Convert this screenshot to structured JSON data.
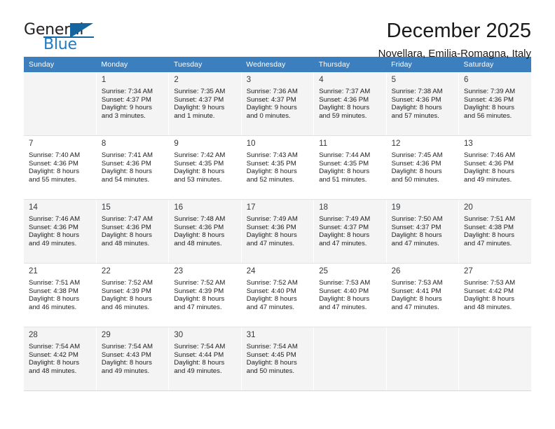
{
  "brand": {
    "name_top": "General",
    "name_bottom": "Blue",
    "color_dark": "#231f20",
    "color_blue": "#1f7ac4",
    "triangle_color": "#15659f"
  },
  "header": {
    "title": "December 2025",
    "subtitle": "Novellara, Emilia-Romagna, Italy"
  },
  "calendar": {
    "header_bg": "#3c7fbe",
    "shaded_row_bg": "#f4f4f4",
    "weekday_headers": [
      "Sunday",
      "Monday",
      "Tuesday",
      "Wednesday",
      "Thursday",
      "Friday",
      "Saturday"
    ],
    "weeks": [
      [
        {
          "day": "",
          "sunrise": "",
          "sunset": "",
          "daylight_line1": "",
          "daylight_line2": ""
        },
        {
          "day": "1",
          "sunrise": "Sunrise: 7:34 AM",
          "sunset": "Sunset: 4:37 PM",
          "daylight_line1": "Daylight: 9 hours",
          "daylight_line2": "and 3 minutes."
        },
        {
          "day": "2",
          "sunrise": "Sunrise: 7:35 AM",
          "sunset": "Sunset: 4:37 PM",
          "daylight_line1": "Daylight: 9 hours",
          "daylight_line2": "and 1 minute."
        },
        {
          "day": "3",
          "sunrise": "Sunrise: 7:36 AM",
          "sunset": "Sunset: 4:37 PM",
          "daylight_line1": "Daylight: 9 hours",
          "daylight_line2": "and 0 minutes."
        },
        {
          "day": "4",
          "sunrise": "Sunrise: 7:37 AM",
          "sunset": "Sunset: 4:36 PM",
          "daylight_line1": "Daylight: 8 hours",
          "daylight_line2": "and 59 minutes."
        },
        {
          "day": "5",
          "sunrise": "Sunrise: 7:38 AM",
          "sunset": "Sunset: 4:36 PM",
          "daylight_line1": "Daylight: 8 hours",
          "daylight_line2": "and 57 minutes."
        },
        {
          "day": "6",
          "sunrise": "Sunrise: 7:39 AM",
          "sunset": "Sunset: 4:36 PM",
          "daylight_line1": "Daylight: 8 hours",
          "daylight_line2": "and 56 minutes."
        }
      ],
      [
        {
          "day": "7",
          "sunrise": "Sunrise: 7:40 AM",
          "sunset": "Sunset: 4:36 PM",
          "daylight_line1": "Daylight: 8 hours",
          "daylight_line2": "and 55 minutes."
        },
        {
          "day": "8",
          "sunrise": "Sunrise: 7:41 AM",
          "sunset": "Sunset: 4:36 PM",
          "daylight_line1": "Daylight: 8 hours",
          "daylight_line2": "and 54 minutes."
        },
        {
          "day": "9",
          "sunrise": "Sunrise: 7:42 AM",
          "sunset": "Sunset: 4:35 PM",
          "daylight_line1": "Daylight: 8 hours",
          "daylight_line2": "and 53 minutes."
        },
        {
          "day": "10",
          "sunrise": "Sunrise: 7:43 AM",
          "sunset": "Sunset: 4:35 PM",
          "daylight_line1": "Daylight: 8 hours",
          "daylight_line2": "and 52 minutes."
        },
        {
          "day": "11",
          "sunrise": "Sunrise: 7:44 AM",
          "sunset": "Sunset: 4:35 PM",
          "daylight_line1": "Daylight: 8 hours",
          "daylight_line2": "and 51 minutes."
        },
        {
          "day": "12",
          "sunrise": "Sunrise: 7:45 AM",
          "sunset": "Sunset: 4:36 PM",
          "daylight_line1": "Daylight: 8 hours",
          "daylight_line2": "and 50 minutes."
        },
        {
          "day": "13",
          "sunrise": "Sunrise: 7:46 AM",
          "sunset": "Sunset: 4:36 PM",
          "daylight_line1": "Daylight: 8 hours",
          "daylight_line2": "and 49 minutes."
        }
      ],
      [
        {
          "day": "14",
          "sunrise": "Sunrise: 7:46 AM",
          "sunset": "Sunset: 4:36 PM",
          "daylight_line1": "Daylight: 8 hours",
          "daylight_line2": "and 49 minutes."
        },
        {
          "day": "15",
          "sunrise": "Sunrise: 7:47 AM",
          "sunset": "Sunset: 4:36 PM",
          "daylight_line1": "Daylight: 8 hours",
          "daylight_line2": "and 48 minutes."
        },
        {
          "day": "16",
          "sunrise": "Sunrise: 7:48 AM",
          "sunset": "Sunset: 4:36 PM",
          "daylight_line1": "Daylight: 8 hours",
          "daylight_line2": "and 48 minutes."
        },
        {
          "day": "17",
          "sunrise": "Sunrise: 7:49 AM",
          "sunset": "Sunset: 4:36 PM",
          "daylight_line1": "Daylight: 8 hours",
          "daylight_line2": "and 47 minutes."
        },
        {
          "day": "18",
          "sunrise": "Sunrise: 7:49 AM",
          "sunset": "Sunset: 4:37 PM",
          "daylight_line1": "Daylight: 8 hours",
          "daylight_line2": "and 47 minutes."
        },
        {
          "day": "19",
          "sunrise": "Sunrise: 7:50 AM",
          "sunset": "Sunset: 4:37 PM",
          "daylight_line1": "Daylight: 8 hours",
          "daylight_line2": "and 47 minutes."
        },
        {
          "day": "20",
          "sunrise": "Sunrise: 7:51 AM",
          "sunset": "Sunset: 4:38 PM",
          "daylight_line1": "Daylight: 8 hours",
          "daylight_line2": "and 47 minutes."
        }
      ],
      [
        {
          "day": "21",
          "sunrise": "Sunrise: 7:51 AM",
          "sunset": "Sunset: 4:38 PM",
          "daylight_line1": "Daylight: 8 hours",
          "daylight_line2": "and 46 minutes."
        },
        {
          "day": "22",
          "sunrise": "Sunrise: 7:52 AM",
          "sunset": "Sunset: 4:39 PM",
          "daylight_line1": "Daylight: 8 hours",
          "daylight_line2": "and 46 minutes."
        },
        {
          "day": "23",
          "sunrise": "Sunrise: 7:52 AM",
          "sunset": "Sunset: 4:39 PM",
          "daylight_line1": "Daylight: 8 hours",
          "daylight_line2": "and 47 minutes."
        },
        {
          "day": "24",
          "sunrise": "Sunrise: 7:52 AM",
          "sunset": "Sunset: 4:40 PM",
          "daylight_line1": "Daylight: 8 hours",
          "daylight_line2": "and 47 minutes."
        },
        {
          "day": "25",
          "sunrise": "Sunrise: 7:53 AM",
          "sunset": "Sunset: 4:40 PM",
          "daylight_line1": "Daylight: 8 hours",
          "daylight_line2": "and 47 minutes."
        },
        {
          "day": "26",
          "sunrise": "Sunrise: 7:53 AM",
          "sunset": "Sunset: 4:41 PM",
          "daylight_line1": "Daylight: 8 hours",
          "daylight_line2": "and 47 minutes."
        },
        {
          "day": "27",
          "sunrise": "Sunrise: 7:53 AM",
          "sunset": "Sunset: 4:42 PM",
          "daylight_line1": "Daylight: 8 hours",
          "daylight_line2": "and 48 minutes."
        }
      ],
      [
        {
          "day": "28",
          "sunrise": "Sunrise: 7:54 AM",
          "sunset": "Sunset: 4:42 PM",
          "daylight_line1": "Daylight: 8 hours",
          "daylight_line2": "and 48 minutes."
        },
        {
          "day": "29",
          "sunrise": "Sunrise: 7:54 AM",
          "sunset": "Sunset: 4:43 PM",
          "daylight_line1": "Daylight: 8 hours",
          "daylight_line2": "and 49 minutes."
        },
        {
          "day": "30",
          "sunrise": "Sunrise: 7:54 AM",
          "sunset": "Sunset: 4:44 PM",
          "daylight_line1": "Daylight: 8 hours",
          "daylight_line2": "and 49 minutes."
        },
        {
          "day": "31",
          "sunrise": "Sunrise: 7:54 AM",
          "sunset": "Sunset: 4:45 PM",
          "daylight_line1": "Daylight: 8 hours",
          "daylight_line2": "and 50 minutes."
        },
        {
          "day": "",
          "sunrise": "",
          "sunset": "",
          "daylight_line1": "",
          "daylight_line2": ""
        },
        {
          "day": "",
          "sunrise": "",
          "sunset": "",
          "daylight_line1": "",
          "daylight_line2": ""
        },
        {
          "day": "",
          "sunrise": "",
          "sunset": "",
          "daylight_line1": "",
          "daylight_line2": ""
        }
      ]
    ]
  }
}
